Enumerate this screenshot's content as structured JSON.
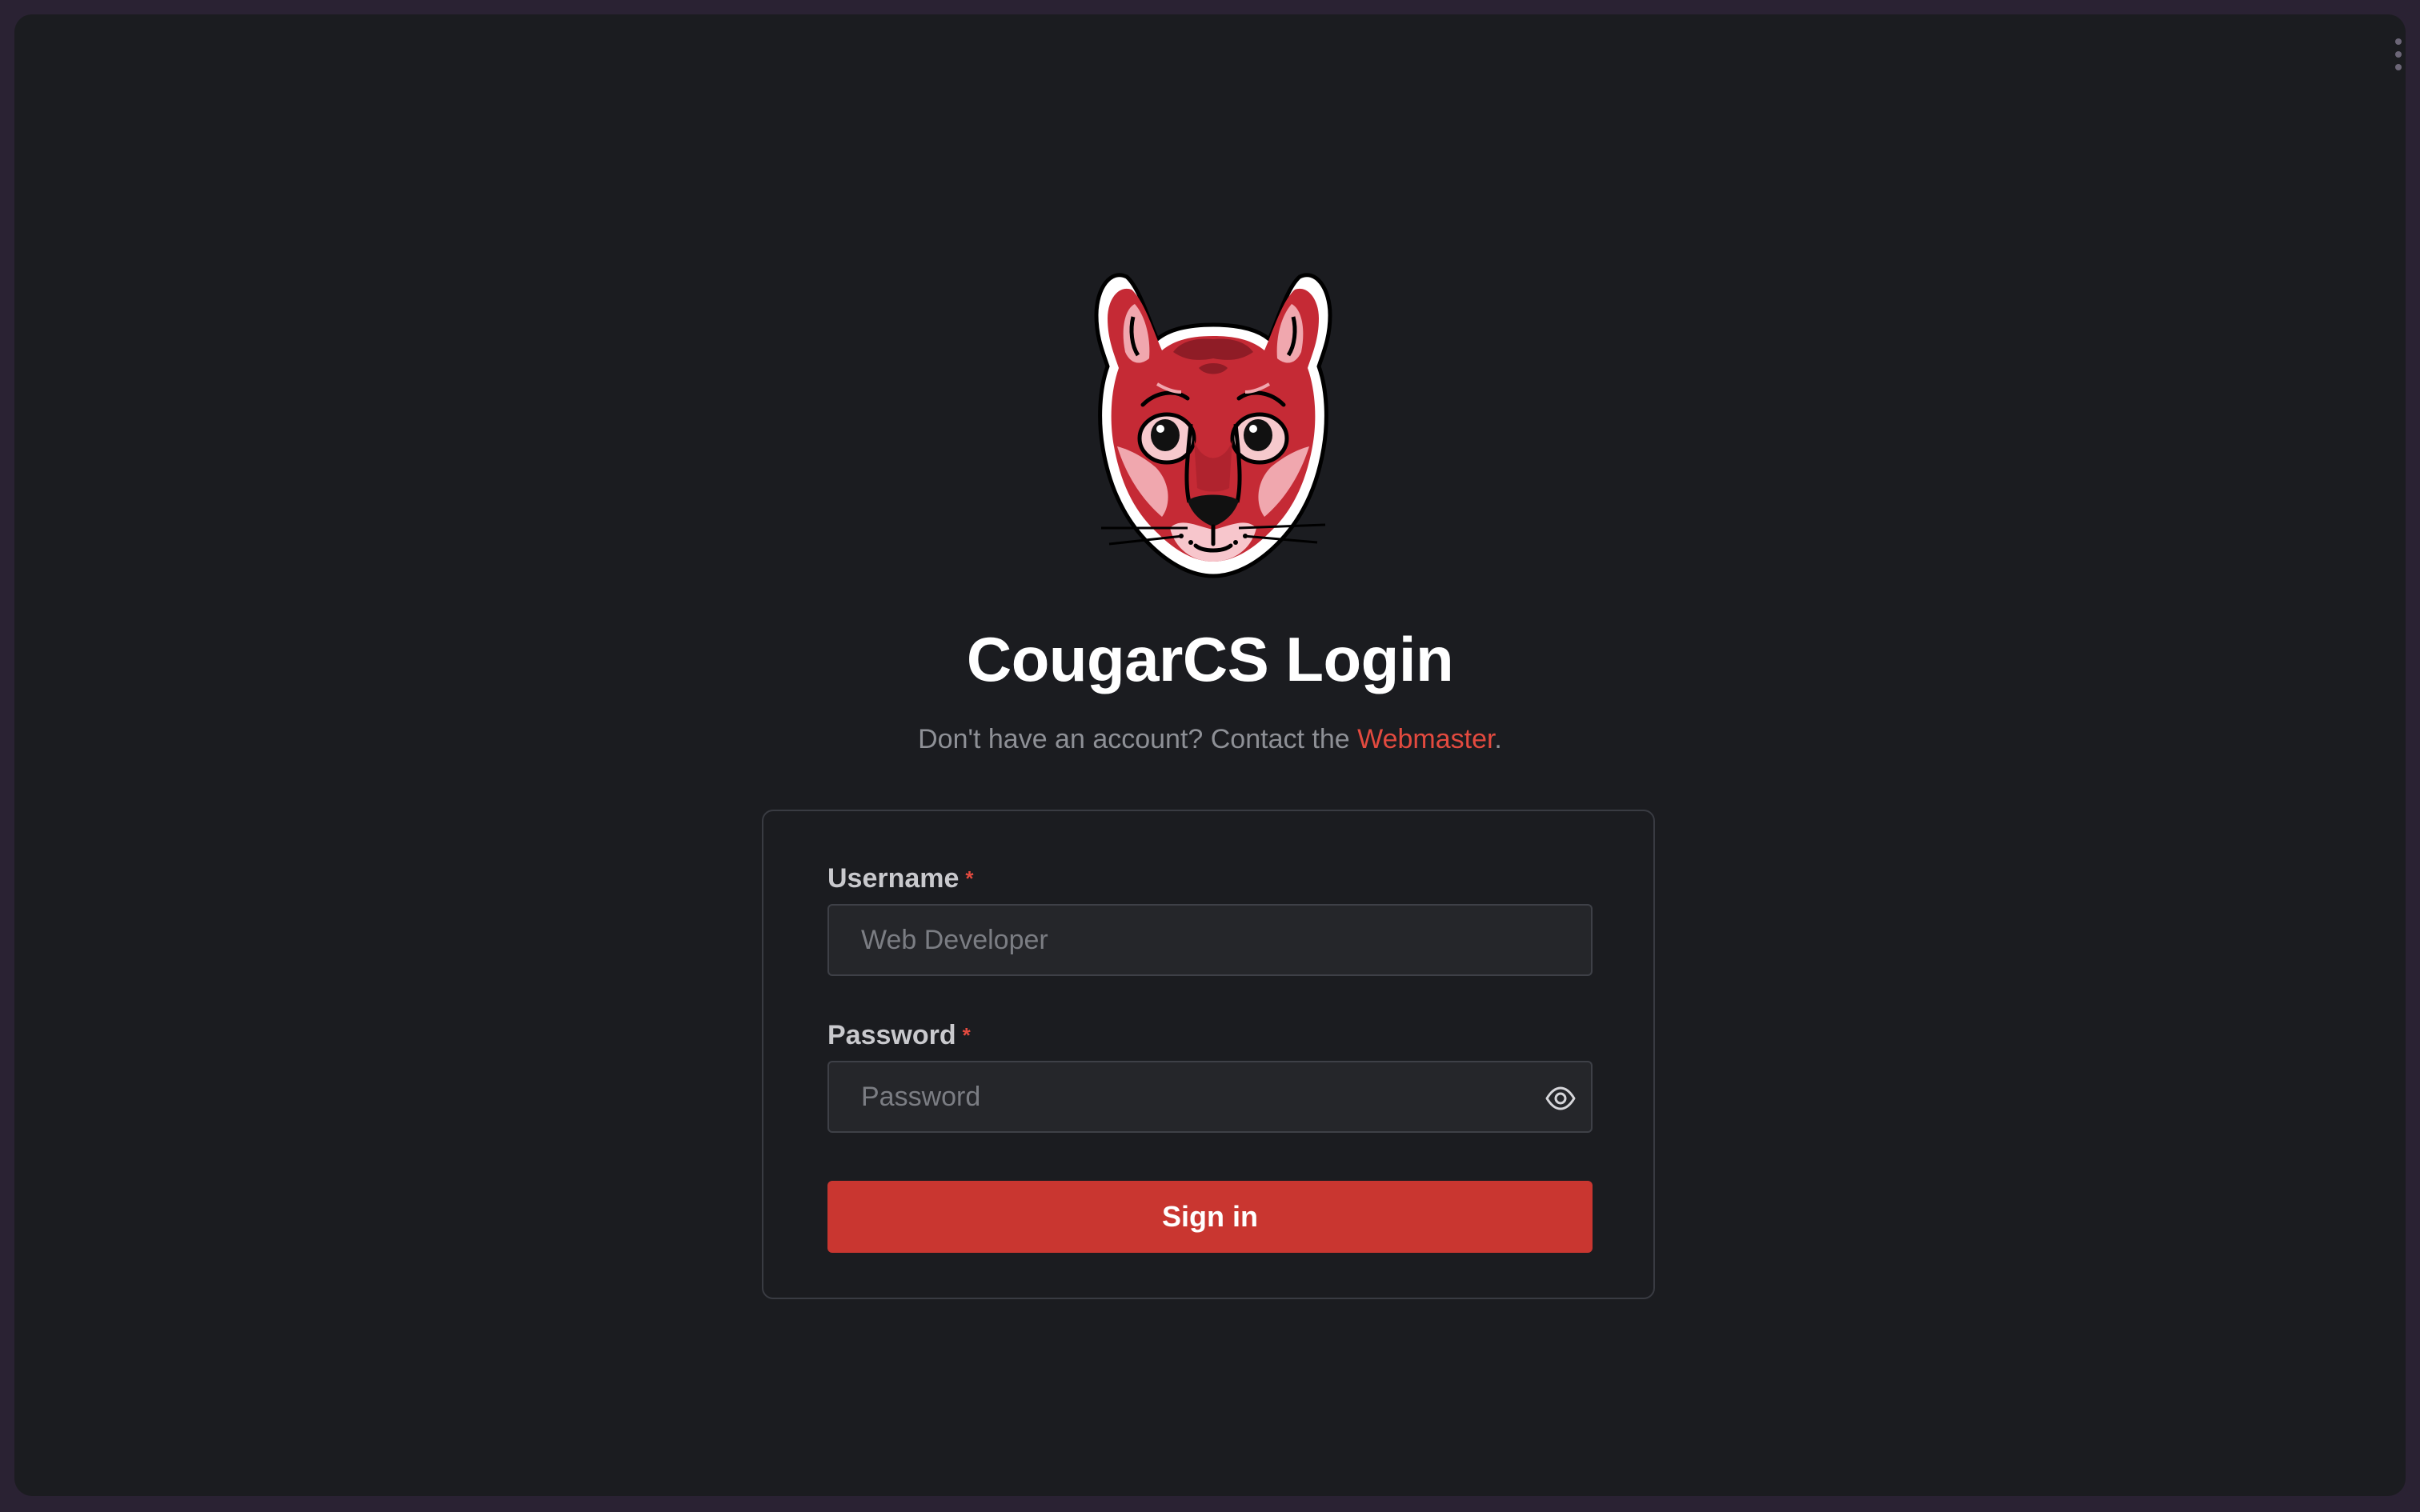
{
  "page": {
    "title": "CougarCS Login",
    "subtitle_prefix": "Don't have an account? Contact the ",
    "subtitle_link": "Webmaster",
    "subtitle_suffix": "."
  },
  "form": {
    "username": {
      "label": "Username",
      "required_mark": "*",
      "placeholder": "Web Developer",
      "value": ""
    },
    "password": {
      "label": "Password",
      "required_mark": "*",
      "placeholder": "Password",
      "value": ""
    },
    "submit_label": "Sign in"
  },
  "icons": {
    "logo": "cougar-mascot-logo",
    "password_toggle": "eye-icon",
    "window_menu": "kebab-menu-icon"
  },
  "colors": {
    "background": "#1b1c20",
    "accent": "#c93630",
    "link": "#e34a3f",
    "input_bg": "#25262a",
    "border": "#393b42"
  }
}
